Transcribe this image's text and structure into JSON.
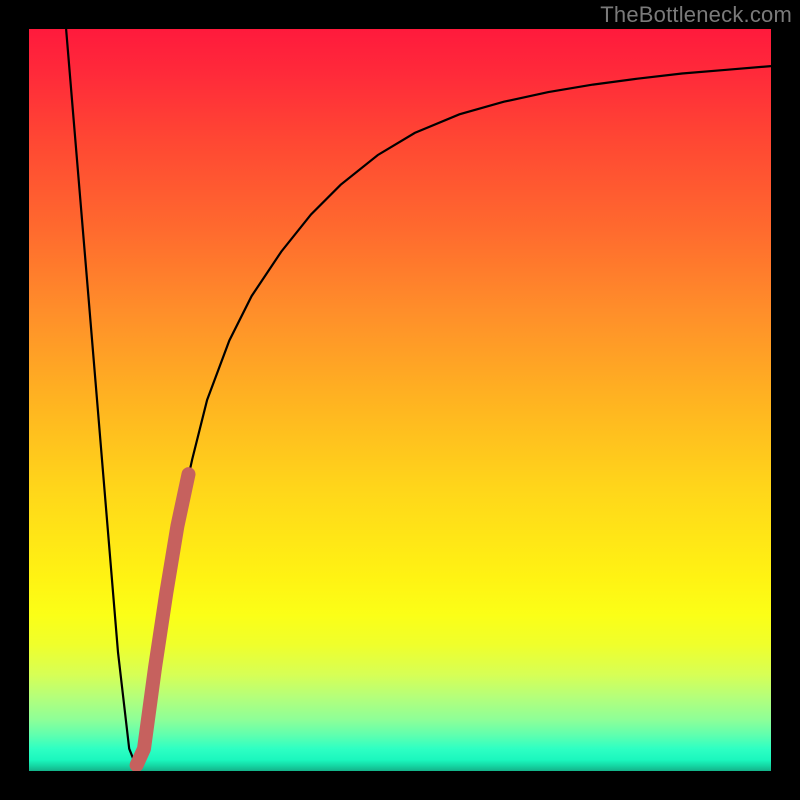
{
  "watermark": "TheBottleneck.com",
  "chart_data": {
    "type": "line",
    "title": "",
    "xlabel": "",
    "ylabel": "",
    "xlim": [
      0,
      100
    ],
    "ylim": [
      0,
      100
    ],
    "series": [
      {
        "name": "main-curve",
        "x": [
          5,
          6,
          8,
          10,
          12,
          13.5,
          14.5,
          15.5,
          17,
          18.5,
          20,
          22,
          24,
          27,
          30,
          34,
          38,
          42,
          47,
          52,
          58,
          64,
          70,
          76,
          82,
          88,
          94,
          100
        ],
        "y": [
          100,
          88,
          64,
          40,
          16,
          3,
          0.5,
          3,
          14,
          24,
          33,
          42,
          50,
          58,
          64,
          70,
          75,
          79,
          83,
          86,
          88.5,
          90.2,
          91.5,
          92.5,
          93.3,
          94,
          94.5,
          95
        ]
      },
      {
        "name": "highlight-segment",
        "x": [
          14.5,
          15.5,
          17,
          18.5,
          20,
          21.5
        ],
        "y": [
          0.8,
          3,
          14,
          24,
          33,
          40
        ]
      }
    ],
    "gradient_stops": [
      {
        "pos": 0,
        "color": "#ff1a3c"
      },
      {
        "pos": 50,
        "color": "#ffd61a"
      },
      {
        "pos": 83,
        "color": "#efff2c"
      },
      {
        "pos": 100,
        "color": "#13b28a"
      }
    ]
  }
}
